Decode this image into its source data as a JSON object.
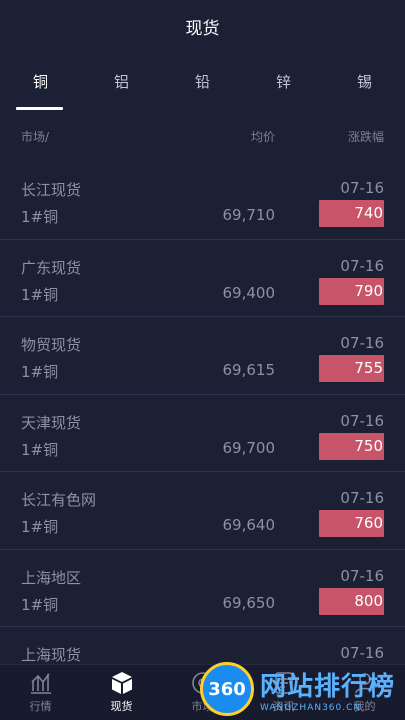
{
  "header": {
    "title": "现货"
  },
  "tabs": [
    {
      "label": "铜"
    },
    {
      "label": "铝"
    },
    {
      "label": "铅"
    },
    {
      "label": "锌"
    },
    {
      "label": "锡"
    }
  ],
  "columns": {
    "market": "市场/",
    "price": "均价",
    "change": "涨跌幅"
  },
  "rows": [
    {
      "market": "长江现货",
      "product": "1#铜",
      "price": "69,710",
      "date": "07-16",
      "change": "740"
    },
    {
      "market": "广东现货",
      "product": "1#铜",
      "price": "69,400",
      "date": "07-16",
      "change": "790"
    },
    {
      "market": "物贸现货",
      "product": "1#铜",
      "price": "69,615",
      "date": "07-16",
      "change": "755"
    },
    {
      "market": "天津现货",
      "product": "1#铜",
      "price": "69,700",
      "date": "07-16",
      "change": "750"
    },
    {
      "market": "长江有色网",
      "product": "1#铜",
      "price": "69,640",
      "date": "07-16",
      "change": "760"
    },
    {
      "market": "上海地区",
      "product": "1#铜",
      "price": "69,650",
      "date": "07-16",
      "change": "800"
    },
    {
      "market": "上海现货",
      "product": "",
      "price": "",
      "date": "07-16",
      "change": ""
    }
  ],
  "bottom_nav": [
    {
      "label": "行情",
      "icon": "chart-icon"
    },
    {
      "label": "现货",
      "icon": "cube-icon"
    },
    {
      "label": "市场",
      "icon": "circle-icon"
    },
    {
      "label": "资讯",
      "icon": "doc-icon"
    },
    {
      "label": "我的",
      "icon": "user-icon"
    }
  ],
  "watermark": {
    "badge": "360",
    "title": "网站排行榜",
    "subtitle": "WANGZHAN360.CN"
  },
  "colors": {
    "background": "#1c2035",
    "up": "#c8546a",
    "divider": "#2e3350"
  }
}
